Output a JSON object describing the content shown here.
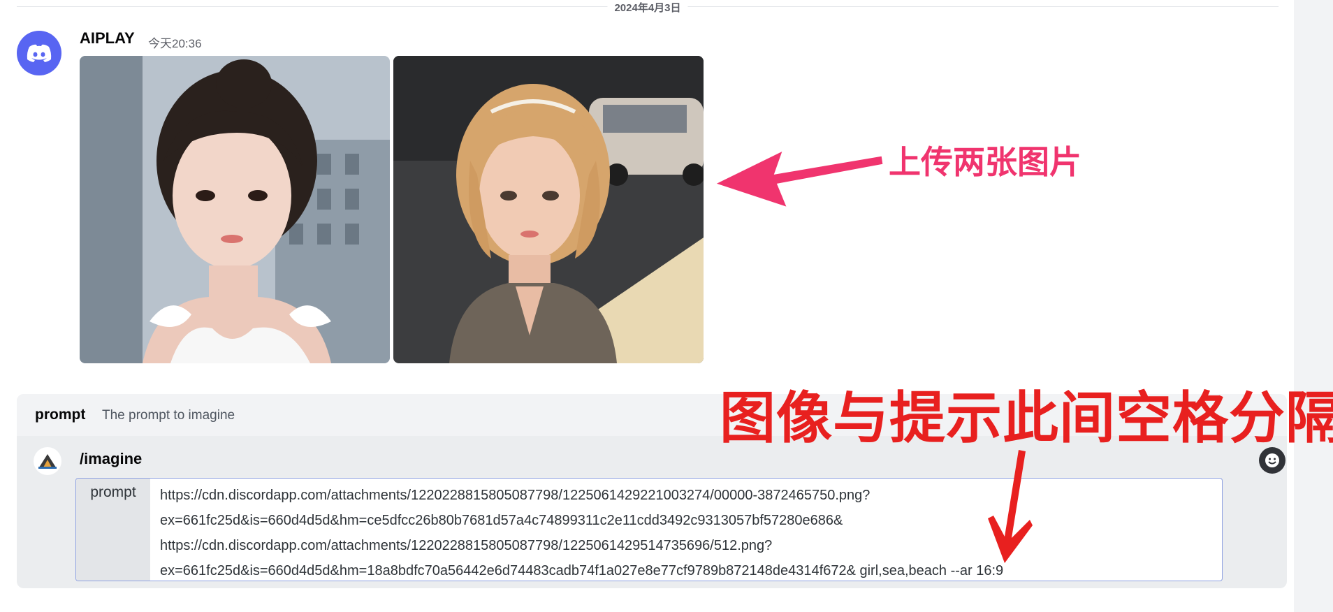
{
  "date_divider": "2024年4月3日",
  "message": {
    "username": "AIPLAY",
    "timestamp": "今天20:36"
  },
  "annotations": {
    "upload_two_images": "上传两张图片",
    "space_between": "图像与提示此间空格分隔"
  },
  "command_panel": {
    "option_name": "prompt",
    "option_description": "The prompt to imagine",
    "command": "/imagine",
    "prompt_label": "prompt",
    "prompt_lines": [
      "https://cdn.discordapp.com/attachments/1220228815805087798/1225061429221003274/00000-3872465750.png?",
      "ex=661fc25d&is=660d4d5d&hm=ce5dfcc26b80b7681d57a4c74899311c2e11cdd3492c9313057bf57280e686&",
      "https://cdn.discordapp.com/attachments/1220228815805087798/1225061429514735696/512.png?",
      "ex=661fc25d&is=660d4d5d&hm=18a8bdfc70a56442e6d74483cadb74f1a027e8e77cf9789b872148de4314f672& girl,sea,beach --ar 16:9"
    ]
  },
  "colors": {
    "annotation_pink": "#f0346e",
    "annotation_red": "#e8201f",
    "discord_blurple": "#5865f2"
  },
  "icons": [
    "discord-logo-icon",
    "app-avatar-icon",
    "emoji-icon"
  ]
}
